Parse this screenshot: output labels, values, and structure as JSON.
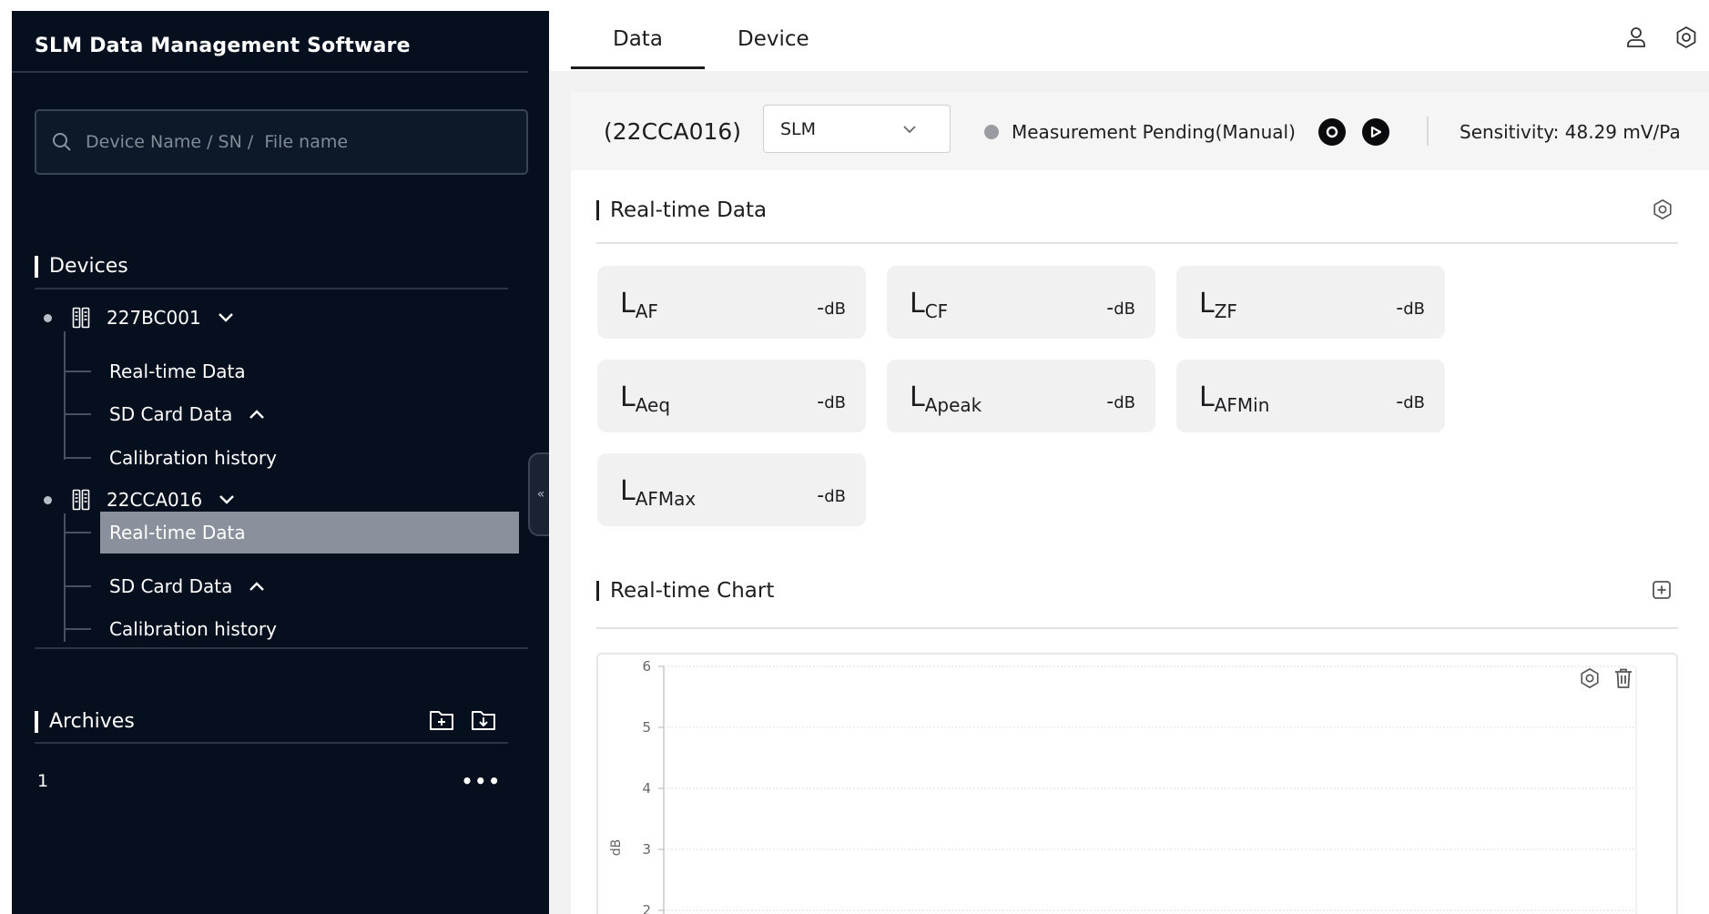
{
  "sidebar": {
    "app_title": "SLM Data Management Software",
    "search_placeholder": "Device Name / SN /  File name",
    "devices_heading": "Devices",
    "devices": [
      {
        "name": "227BC001",
        "items": [
          {
            "label": "Real-time Data"
          },
          {
            "label": "SD Card Data"
          },
          {
            "label": "Calibration history"
          }
        ]
      },
      {
        "name": "22CCA016",
        "items": [
          {
            "label": "Real-time Data"
          },
          {
            "label": "SD Card Data"
          },
          {
            "label": "Calibration history"
          }
        ]
      }
    ],
    "active_item": "22CCA016 / Real-time Data",
    "archives_heading": "Archives",
    "archives": [
      {
        "name": "1",
        "menu": "•••"
      }
    ],
    "collapse_glyph": "«"
  },
  "tabs": [
    {
      "label": "Data",
      "active": true
    },
    {
      "label": "Device",
      "active": false
    }
  ],
  "toolbar": {
    "device_id": "(22CCA016)",
    "mode_selected": "SLM",
    "status_text": "Measurement Pending(Manual)",
    "sensitivity": "Sensitivity: 48.29 mV/Pa"
  },
  "realtime": {
    "heading": "Real-time Data",
    "metrics": [
      {
        "base": "L",
        "sub": "AF",
        "value": "-",
        "unit": "dB"
      },
      {
        "base": "L",
        "sub": "CF",
        "value": "-",
        "unit": "dB"
      },
      {
        "base": "L",
        "sub": "ZF",
        "value": "-",
        "unit": "dB"
      },
      {
        "base": "L",
        "sub": "Aeq",
        "value": "-",
        "unit": "dB"
      },
      {
        "base": "L",
        "sub": "Apeak",
        "value": "-",
        "unit": "dB"
      },
      {
        "base": "L",
        "sub": "AFMin",
        "value": "-",
        "unit": "dB"
      },
      {
        "base": "L",
        "sub": "AFMax",
        "value": "-",
        "unit": "dB"
      }
    ]
  },
  "chart_section": {
    "heading": "Real-time Chart"
  },
  "chart_data": {
    "type": "line",
    "title": "",
    "xlabel": "",
    "ylabel": "dB",
    "ylim": [
      2,
      6
    ],
    "y_ticks": [
      6,
      5,
      4,
      3,
      2
    ],
    "series": [],
    "grid": true
  },
  "colors": {
    "sidebar_bg": "#050f1e",
    "active_item_bg": "#8a919c",
    "status_dot": "#9a9ca2",
    "main_bg": "#f2f2f3"
  },
  "icons": {
    "search": "search-icon",
    "device": "device-icon",
    "user": "user-icon",
    "settings": "gear-icon",
    "record": "record-icon",
    "play": "play-icon",
    "add": "add-box-icon",
    "folder_add": "folder-add-icon",
    "folder_import": "folder-import-icon",
    "delete": "trash-icon"
  }
}
